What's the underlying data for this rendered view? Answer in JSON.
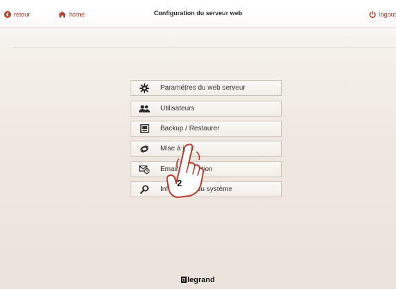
{
  "header": {
    "back_label": "retour",
    "home_label": "home",
    "title": "Configuration du serveur web",
    "logout_label": "logout"
  },
  "menu": {
    "items": [
      {
        "label": "Paramétres du web serveur",
        "icon": "gear-icon"
      },
      {
        "label": "Utilisateurs",
        "icon": "users-icon"
      },
      {
        "label": "Backup / Restaurer",
        "icon": "backup-icon"
      },
      {
        "label": "Mise à jour",
        "icon": "update-icon"
      },
      {
        "label": "Email notification",
        "icon": "email-notification-icon"
      },
      {
        "label": "Information du système",
        "icon": "search-icon"
      }
    ]
  },
  "callout": {
    "step_number": "2"
  },
  "footer": {
    "brand": "legrand"
  },
  "colors": {
    "accent": "#b83a2c",
    "text": "#333333",
    "border": "#c9c0b6"
  }
}
